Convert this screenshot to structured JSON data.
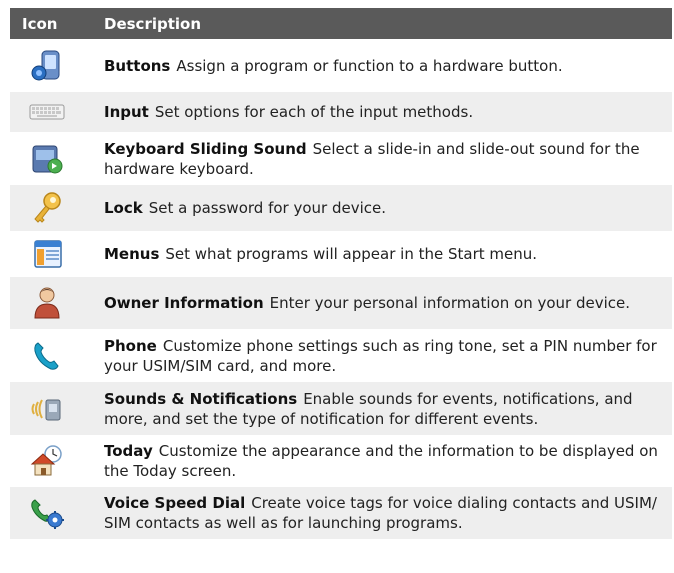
{
  "header": {
    "icon": "Icon",
    "description": "Description"
  },
  "rows": [
    {
      "name": "Buttons",
      "desc": "Assign a program or function to a hardware button.",
      "icon": "phone-button-icon"
    },
    {
      "name": "Input",
      "desc": "Set options for each of the input methods.",
      "icon": "keyboard-icon"
    },
    {
      "name": "Keyboard Sliding Sound",
      "desc": "Select a slide-in and slide-out sound for the hardware keyboard.",
      "icon": "keyboard-sound-icon"
    },
    {
      "name": "Lock",
      "desc": "Set a password for your device.",
      "icon": "key-icon"
    },
    {
      "name": "Menus",
      "desc": "Set what programs will appear in the Start menu.",
      "icon": "menu-window-icon"
    },
    {
      "name": "Owner Information",
      "desc": "Enter your personal information on your device.",
      "icon": "person-icon"
    },
    {
      "name": "Phone",
      "desc": "Customize phone settings such as ring tone, set a PIN number for your USIM/SIM card, and more.",
      "icon": "phone-handset-icon"
    },
    {
      "name": "Sounds & Notifications",
      "desc": "Enable sounds for events, notifications, and more, and set the type of notification for different events.",
      "icon": "sound-notification-icon"
    },
    {
      "name": "Today",
      "desc": "Customize the appearance and the information to be displayed on the Today screen.",
      "icon": "home-clock-icon"
    },
    {
      "name": "Voice Speed Dial",
      "desc": "Create voice tags for voice dialing contacts and USIM/ SIM contacts as well as for launching programs.",
      "icon": "voice-dial-gear-icon"
    }
  ]
}
